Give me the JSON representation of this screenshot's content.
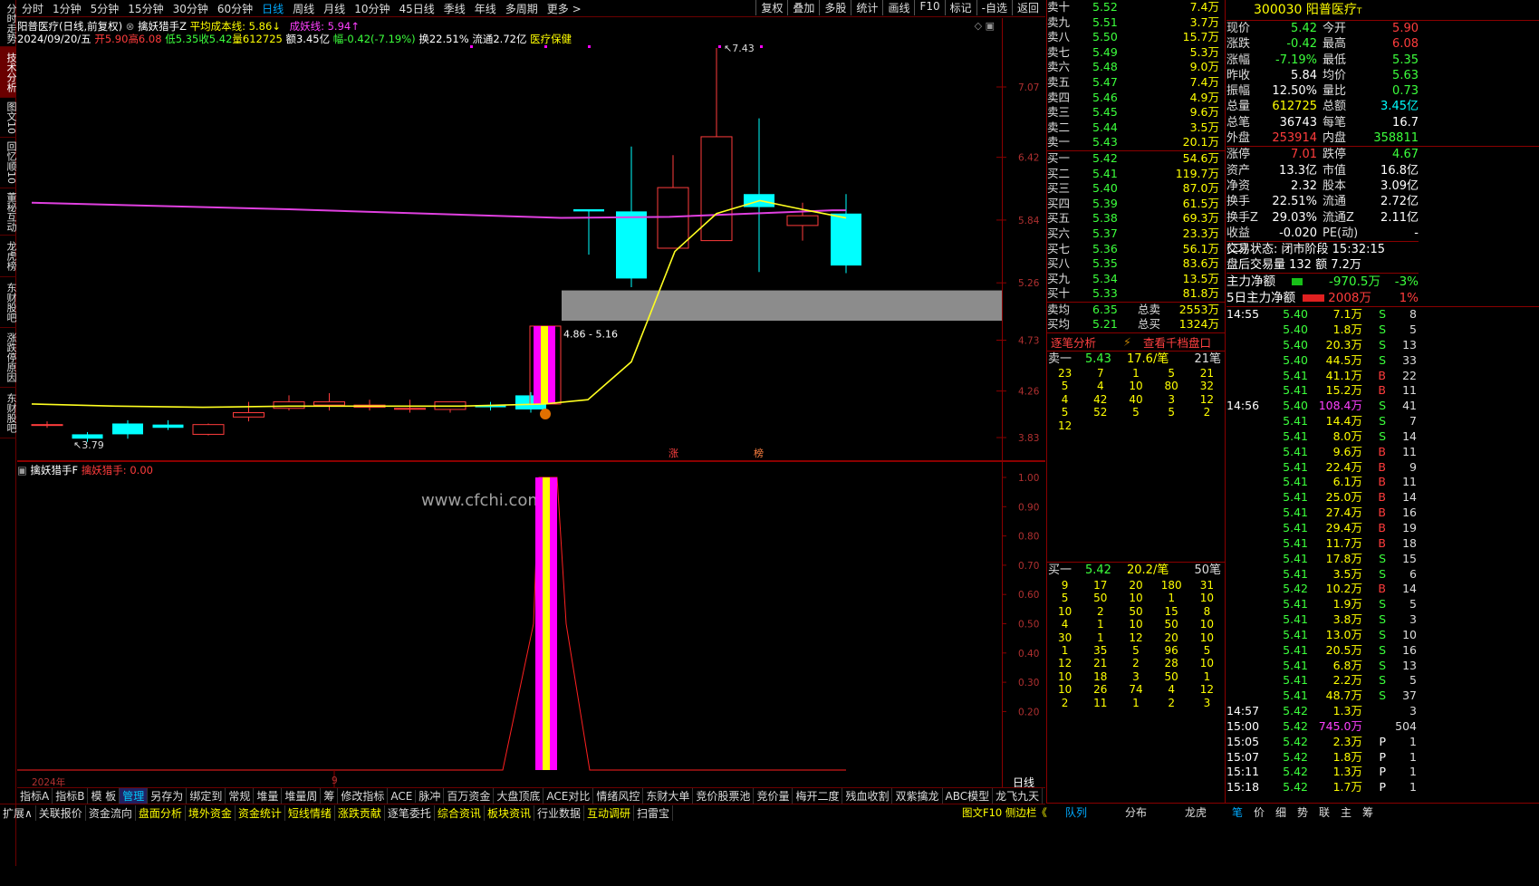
{
  "left_tabs": [
    "分时走势",
    "技术分析",
    "图文10",
    "回忆顺10",
    "董秘互动",
    "龙虎榜",
    "东财股吧",
    "涨跌停原因",
    "东财股吧"
  ],
  "periods": [
    "分时",
    "1分钟",
    "5分钟",
    "15分钟",
    "30分钟",
    "60分钟",
    "日线",
    "周线",
    "月线",
    "10分钟",
    "45日线",
    "季线",
    "年线",
    "多周期",
    "更多 >"
  ],
  "top_right": [
    "复权",
    "叠加",
    "多股",
    "统计",
    "画线",
    "F10",
    "标记",
    "-自选",
    "返回"
  ],
  "header": {
    "name": "阳普医疗(日线,前复权)",
    "indicator": "擒妖猎手Z",
    "avg_cost_label": "平均成本线: 5.86↓",
    "yao_label": "成妖线: 5.94↑",
    "date": "2024/09/20/五",
    "open": "开5.90",
    "high": "高6.08",
    "low": "低5.35",
    "close": "收5.42",
    "vol": "量612725",
    "amt": "额3.45亿",
    "chg": "幅-0.42(-7.19%)",
    "turn": "换22.51%",
    "flow": "流通2.72亿",
    "sector": "医疗保健"
  },
  "chart_data": [
    {
      "type": "candlestick",
      "title": "阳普医疗(日线,前复权)",
      "y_ticks": [
        7.07,
        6.42,
        5.84,
        5.26,
        4.73,
        4.26,
        3.83
      ],
      "ylim": [
        3.7,
        7.6
      ],
      "candles": [
        {
          "o": 3.95,
          "h": 3.98,
          "l": 3.92,
          "c": 3.95
        },
        {
          "o": 3.86,
          "h": 3.88,
          "l": 3.79,
          "c": 3.82
        },
        {
          "o": 3.96,
          "h": 3.99,
          "l": 3.82,
          "c": 3.86
        },
        {
          "o": 3.95,
          "h": 3.99,
          "l": 3.9,
          "c": 3.92
        },
        {
          "o": 3.86,
          "h": 3.96,
          "l": 3.85,
          "c": 3.95
        },
        {
          "o": 4.02,
          "h": 4.16,
          "l": 3.98,
          "c": 4.06
        },
        {
          "o": 4.1,
          "h": 4.22,
          "l": 4.08,
          "c": 4.16
        },
        {
          "o": 4.13,
          "h": 4.24,
          "l": 4.08,
          "c": 4.16
        },
        {
          "o": 4.11,
          "h": 4.18,
          "l": 4.08,
          "c": 4.13
        },
        {
          "o": 4.1,
          "h": 4.18,
          "l": 4.06,
          "c": 4.1
        },
        {
          "o": 4.09,
          "h": 4.16,
          "l": 4.06,
          "c": 4.16
        },
        {
          "o": 4.13,
          "h": 4.16,
          "l": 4.08,
          "c": 4.11
        },
        {
          "o": 4.22,
          "h": 4.25,
          "l": 4.06,
          "c": 4.09
        },
        {
          "o": 4.13,
          "h": 4.82,
          "l": 4.1,
          "c": 4.86
        },
        {
          "o": 5.94,
          "h": 5.94,
          "l": 5.52,
          "c": 5.92
        },
        {
          "o": 5.92,
          "h": 6.52,
          "l": 5.22,
          "c": 5.3
        },
        {
          "o": 5.58,
          "h": 6.44,
          "l": 5.58,
          "c": 6.14
        },
        {
          "o": 5.65,
          "h": 7.43,
          "l": 5.65,
          "c": 6.61
        },
        {
          "o": 6.08,
          "h": 6.78,
          "l": 5.36,
          "c": 5.96
        },
        {
          "o": 5.79,
          "h": 6.0,
          "l": 5.65,
          "c": 5.88
        },
        {
          "o": 5.9,
          "h": 6.08,
          "l": 5.35,
          "c": 5.42
        }
      ],
      "annotations": [
        "7.43",
        "3.79",
        "4.86 - 5.16"
      ],
      "markers": [
        "涨",
        "榜"
      ]
    },
    {
      "type": "bar",
      "title": "擒妖猎手F",
      "series": [
        {
          "name": "擒妖猎手",
          "values": [
            0,
            0,
            0,
            0,
            0,
            0,
            0,
            0,
            0,
            0,
            0,
            0,
            0,
            1,
            0,
            0,
            0,
            0,
            0,
            0,
            0
          ]
        }
      ],
      "y_ticks": [
        1.0,
        0.9,
        0.8,
        0.7,
        0.6,
        0.5,
        0.4,
        0.3,
        0.2
      ],
      "ylim": [
        0,
        1.05
      ]
    }
  ],
  "sub_header": {
    "name": "擒妖猎手F",
    "label": "擒妖猎手: 0.00"
  },
  "watermark": "www.cfchi.com",
  "x_labels": [
    "2024年",
    "9"
  ],
  "period_tag": "日线",
  "tabs1": [
    "指标A",
    "指标B",
    "模 板",
    "管理",
    "另存为",
    "绑定到",
    "常规",
    "堆量",
    "堆量周",
    "筹",
    "修改指标",
    "ACE",
    "脉冲",
    "百万资金",
    "大盘顶底",
    "ACE对比",
    "情绪风控",
    "东财大单",
    "竞价股票池",
    "竞价量",
    "梅开二度",
    "残血收割",
    "双紫擒龙",
    "ABC模型",
    "龙飞九天",
    ">",
    "+",
    "-"
  ],
  "tabs2": [
    {
      "t": "扩展∧",
      "c": "#ddd"
    },
    {
      "t": "关联报价",
      "c": "#ddd"
    },
    {
      "t": "资金流向",
      "c": "#ddd"
    },
    {
      "t": "盘面分析",
      "c": "#ffff00"
    },
    {
      "t": "境外资金",
      "c": "#ffff00"
    },
    {
      "t": "资金统计",
      "c": "#ffff00"
    },
    {
      "t": "短线情绪",
      "c": "#ffff00"
    },
    {
      "t": "涨跌贡献",
      "c": "#ffff00"
    },
    {
      "t": "逐笔委托",
      "c": "#ddd"
    },
    {
      "t": "综合资讯",
      "c": "#ffff00"
    },
    {
      "t": "板块资讯",
      "c": "#ffff00"
    },
    {
      "t": "行业数据",
      "c": "#ddd"
    },
    {
      "t": "互动调研",
      "c": "#ffff00"
    },
    {
      "t": "扫雷宝",
      "c": "#ddd"
    }
  ],
  "tabs2_right": "图文F10 侧边栏《",
  "sells": [
    [
      "卖十",
      "5.52",
      "7.4万"
    ],
    [
      "卖九",
      "5.51",
      "3.7万"
    ],
    [
      "卖八",
      "5.50",
      "15.7万"
    ],
    [
      "卖七",
      "5.49",
      "5.3万"
    ],
    [
      "卖六",
      "5.48",
      "9.0万"
    ],
    [
      "卖五",
      "5.47",
      "7.4万"
    ],
    [
      "卖四",
      "5.46",
      "4.9万"
    ],
    [
      "卖三",
      "5.45",
      "9.6万"
    ],
    [
      "卖二",
      "5.44",
      "3.5万"
    ],
    [
      "卖一",
      "5.43",
      "20.1万"
    ]
  ],
  "buys": [
    [
      "买一",
      "5.42",
      "54.6万"
    ],
    [
      "买二",
      "5.41",
      "119.7万"
    ],
    [
      "买三",
      "5.40",
      "87.0万"
    ],
    [
      "买四",
      "5.39",
      "61.5万"
    ],
    [
      "买五",
      "5.38",
      "69.3万"
    ],
    [
      "买六",
      "5.37",
      "23.3万"
    ],
    [
      "买七",
      "5.36",
      "56.1万"
    ],
    [
      "买八",
      "5.35",
      "83.6万"
    ],
    [
      "买九",
      "5.34",
      "13.5万"
    ],
    [
      "买十",
      "5.33",
      "81.8万"
    ]
  ],
  "avg": {
    "sell_label": "卖均",
    "sell_avg": "6.35",
    "sell_total_label": "总卖",
    "sell_total": "2553万",
    "buy_label": "买均",
    "buy_avg": "5.21",
    "buy_total_label": "总买",
    "buy_total": "1324万"
  },
  "tick_links": {
    "a": "逐笔分析",
    "b": "查看千档盘口"
  },
  "sell1": {
    "label": "卖一",
    "price": "5.43",
    "per": "17.6/笔",
    "count": "21笔",
    "queue": [
      "23",
      "7",
      "1",
      "5",
      "21",
      "5",
      "4",
      "10",
      "80",
      "32",
      "4",
      "42",
      "40",
      "3",
      "12",
      "5",
      "52",
      "5",
      "5",
      "2",
      "12"
    ]
  },
  "buy1": {
    "label": "买一",
    "price": "5.42",
    "per": "20.2/笔",
    "count": "50笔",
    "queue": [
      "9",
      "17",
      "20",
      "180",
      "31",
      "5",
      "50",
      "10",
      "1",
      "10",
      "10",
      "2",
      "50",
      "15",
      "8",
      "4",
      "1",
      "10",
      "50",
      "10",
      "30",
      "1",
      "12",
      "20",
      "10",
      "1",
      "35",
      "5",
      "96",
      "5",
      "12",
      "21",
      "2",
      "28",
      "10",
      "10",
      "18",
      "3",
      "50",
      "1",
      "10",
      "26",
      "74",
      "4",
      "12",
      "2",
      "11",
      "1",
      "2",
      "3"
    ]
  },
  "stock": {
    "code": "300030",
    "name": "阳普医疗"
  },
  "quote": [
    [
      "现价",
      "5.42",
      "今开",
      "5.90"
    ],
    [
      "涨跌",
      "-0.42",
      "最高",
      "6.08"
    ],
    [
      "涨幅",
      "-7.19%",
      "最低",
      "5.35"
    ],
    [
      "昨收",
      "5.84",
      "均价",
      "5.63"
    ],
    [
      "振幅",
      "12.50%",
      "量比",
      "0.73"
    ],
    [
      "总量",
      "612725",
      "总额",
      "3.45亿"
    ],
    [
      "总笔",
      "36743",
      "每笔",
      "16.7"
    ],
    [
      "外盘",
      "253914",
      "内盘",
      "358811"
    ]
  ],
  "quote2": [
    [
      "涨停",
      "7.01",
      "跌停",
      "4.67"
    ],
    [
      "资产",
      "13.3亿",
      "市值",
      "16.8亿"
    ],
    [
      "净资",
      "2.32",
      "股本",
      "3.09亿"
    ],
    [
      "换手",
      "22.51%",
      "流通",
      "2.72亿"
    ],
    [
      "换手Z",
      "29.03%",
      "流通Z",
      "2.11亿"
    ],
    [
      "收益(二)",
      "-0.020",
      "PE(动)",
      "-"
    ]
  ],
  "status": {
    "a": "交易状态: 闭市阶段",
    "b": "15:32:15",
    "c": "盘后交易量 132 额 7.2万"
  },
  "flow": {
    "a": "主力净额",
    "a_val": "-970.5万",
    "a_pct": "-3%",
    "b": "5日主力净额",
    "b_val": "2008万",
    "b_pct": "1%"
  },
  "ticks": [
    [
      "14:55",
      "5.40",
      "7.1万",
      "S",
      "8"
    ],
    [
      "",
      "5.40",
      "1.8万",
      "S",
      "5"
    ],
    [
      "",
      "5.40",
      "20.3万",
      "S",
      "13"
    ],
    [
      "",
      "5.40",
      "44.5万",
      "S",
      "33"
    ],
    [
      "",
      "5.41",
      "41.1万",
      "B",
      "22"
    ],
    [
      "",
      "5.41",
      "15.2万",
      "B",
      "11"
    ],
    [
      "14:56",
      "5.40",
      "108.4万",
      "S",
      "41"
    ],
    [
      "",
      "5.41",
      "14.4万",
      "S",
      "7"
    ],
    [
      "",
      "5.41",
      "8.0万",
      "S",
      "14"
    ],
    [
      "",
      "5.41",
      "9.6万",
      "B",
      "11"
    ],
    [
      "",
      "5.41",
      "22.4万",
      "B",
      "9"
    ],
    [
      "",
      "5.41",
      "6.1万",
      "B",
      "11"
    ],
    [
      "",
      "5.41",
      "25.0万",
      "B",
      "14"
    ],
    [
      "",
      "5.41",
      "27.4万",
      "B",
      "16"
    ],
    [
      "",
      "5.41",
      "29.4万",
      "B",
      "19"
    ],
    [
      "",
      "5.41",
      "11.7万",
      "B",
      "18"
    ],
    [
      "",
      "5.41",
      "17.8万",
      "S",
      "15"
    ],
    [
      "",
      "5.41",
      "3.5万",
      "S",
      "6"
    ],
    [
      "",
      "5.42",
      "10.2万",
      "B",
      "14"
    ],
    [
      "",
      "5.41",
      "1.9万",
      "S",
      "5"
    ],
    [
      "",
      "5.41",
      "3.8万",
      "S",
      "3"
    ],
    [
      "",
      "5.41",
      "13.0万",
      "S",
      "10"
    ],
    [
      "",
      "5.41",
      "20.5万",
      "S",
      "16"
    ],
    [
      "",
      "5.41",
      "6.8万",
      "S",
      "13"
    ],
    [
      "",
      "5.41",
      "2.2万",
      "S",
      "5"
    ],
    [
      "",
      "5.41",
      "48.7万",
      "S",
      "37"
    ],
    [
      "14:57",
      "5.42",
      "1.3万",
      "",
      "3"
    ],
    [
      "15:00",
      "5.42",
      "745.0万",
      "",
      "504"
    ],
    [
      "15:05",
      "5.42",
      "2.3万",
      "P",
      "1"
    ],
    [
      "15:07",
      "5.42",
      "1.8万",
      "P",
      "1"
    ],
    [
      "15:11",
      "5.42",
      "1.3万",
      "P",
      "1"
    ],
    [
      "15:18",
      "5.42",
      "1.7万",
      "P",
      "1"
    ]
  ],
  "rbottom": [
    "队列",
    "分布",
    "龙虎",
    "笔",
    "价",
    "细",
    "势",
    "联",
    "主",
    "筹"
  ]
}
